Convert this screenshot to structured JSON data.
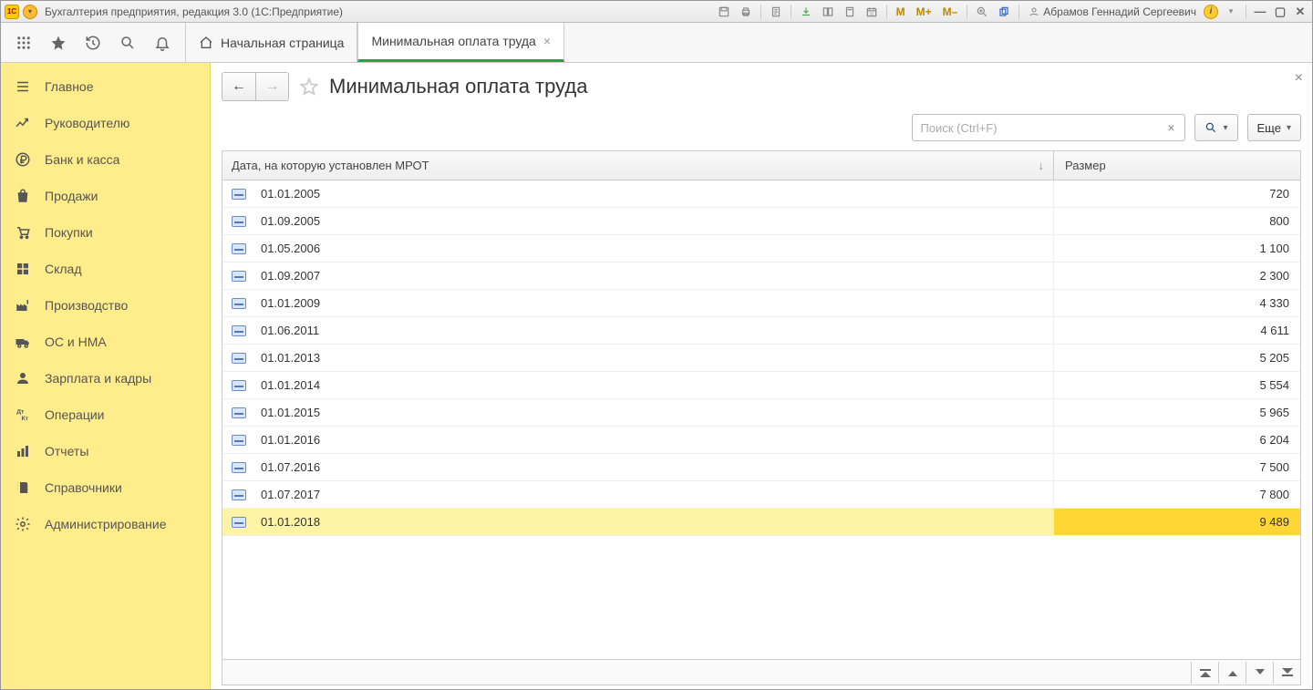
{
  "titlebar": {
    "app_title": "Бухгалтерия предприятия, редакция 3.0  (1С:Предприятие)",
    "mem_m": "M",
    "mem_mplus": "M+",
    "mem_mminus": "M–",
    "user_name": "Абрамов Геннадий Сергеевич"
  },
  "tabs": {
    "home": "Начальная страница",
    "active": "Минимальная оплата труда"
  },
  "sidebar": {
    "items": [
      {
        "label": "Главное"
      },
      {
        "label": "Руководителю"
      },
      {
        "label": "Банк и касса"
      },
      {
        "label": "Продажи"
      },
      {
        "label": "Покупки"
      },
      {
        "label": "Склад"
      },
      {
        "label": "Производство"
      },
      {
        "label": "ОС и НМА"
      },
      {
        "label": "Зарплата и кадры"
      },
      {
        "label": "Операции"
      },
      {
        "label": "Отчеты"
      },
      {
        "label": "Справочники"
      },
      {
        "label": "Администрирование"
      }
    ]
  },
  "page": {
    "title": "Минимальная оплата труда",
    "search_placeholder": "Поиск (Ctrl+F)",
    "more_label": "Еще"
  },
  "table": {
    "col_date": "Дата, на которую установлен МРОТ",
    "col_size": "Размер",
    "rows": [
      {
        "date": "01.01.2005",
        "size": "720"
      },
      {
        "date": "01.09.2005",
        "size": "800"
      },
      {
        "date": "01.05.2006",
        "size": "1 100"
      },
      {
        "date": "01.09.2007",
        "size": "2 300"
      },
      {
        "date": "01.01.2009",
        "size": "4 330"
      },
      {
        "date": "01.06.2011",
        "size": "4 611"
      },
      {
        "date": "01.01.2013",
        "size": "5 205"
      },
      {
        "date": "01.01.2014",
        "size": "5 554"
      },
      {
        "date": "01.01.2015",
        "size": "5 965"
      },
      {
        "date": "01.01.2016",
        "size": "6 204"
      },
      {
        "date": "01.07.2016",
        "size": "7 500"
      },
      {
        "date": "01.07.2017",
        "size": "7 800"
      },
      {
        "date": "01.01.2018",
        "size": "9 489"
      }
    ],
    "selected_index": 12
  }
}
